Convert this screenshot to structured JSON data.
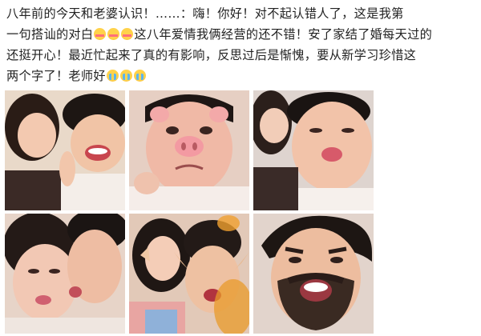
{
  "post": {
    "line1": "八年前的今天和老婆认识！……：嗨！你好！对不起认错人了，这是我第",
    "line2a": "一句搭讪的对白",
    "line2b": "这八年爱情我俩经营的还不错！安了家结了婚每天过的",
    "line3": "还挺开心！最近忙起来了真的有影响，反思过后是惭愧，要从新学习珍惜这",
    "line4": "两个字了！老师好",
    "emoji_blush": "blush-emoji",
    "emoji_cry": "crying-emoji"
  },
  "photos": [
    {
      "name": "photo-couple-laughing"
    },
    {
      "name": "photo-pig-filter"
    },
    {
      "name": "photo-pout-face"
    },
    {
      "name": "photo-kiss-cheek"
    },
    {
      "name": "photo-elf-filter"
    },
    {
      "name": "photo-beard-filter"
    }
  ],
  "colors": {
    "text": "#222222",
    "background": "#ffffff"
  }
}
